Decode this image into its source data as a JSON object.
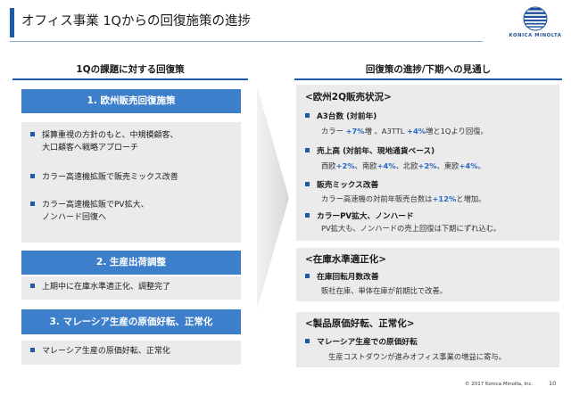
{
  "header": {
    "title": "オフィス事業 1Qからの回復施策の進捗"
  },
  "logo": {
    "text": "KONICA MINOLTA"
  },
  "left": {
    "heading": "1Qの課題に対する回復策",
    "sections": [
      {
        "title": "1. 欧州販売回復施策",
        "items": [
          [
            "採算重視の方針のもと、中規模顧客、",
            "大口顧客へ戦略アプローチ"
          ],
          [
            "カラー高速機拡販で販売ミックス改善"
          ],
          [
            "カラー高速機拡販でPV拡大、",
            "ノンハード回復へ"
          ]
        ]
      },
      {
        "title": "2. 生産出荷調整",
        "items": [
          [
            "上期中に在庫水準適正化、調整完了"
          ]
        ]
      },
      {
        "title": "3. マレーシア生産の原価好転、正常化",
        "items": [
          [
            "マレーシア生産の原価好転、正常化"
          ]
        ]
      }
    ]
  },
  "right": {
    "heading": "回復策の進捗/下期への見通し",
    "panel1": {
      "title": "<欧州2Q販売状況>",
      "a3": {
        "label": "A3台数 (対前年)",
        "p1": "カラー ",
        "v1": "+7%",
        "p2": "増 、A3TTL ",
        "v2": "+4%",
        "p3": "増と1Qより回復。"
      },
      "sales": {
        "label": "売上高 (対前年、現地通貨ベース)",
        "p1": "西欧",
        "v1": "+2%",
        "p2": "、南欧",
        "v2": "+4%",
        "p3": "、北欧",
        "v3": "+2%",
        "p4": "、東欧",
        "v4": "+4%",
        "p5": "。"
      },
      "mix": {
        "label": "販売ミックス改善",
        "p1": "カラー高速機の対前年販売台数は",
        "v1": "+12%",
        "p2": "と増加。"
      },
      "pv": {
        "label": "カラーPV拡大、ノンハード",
        "detail": "PV拡大も、ノンハードの売上回復は下期にずれ込む。"
      }
    },
    "panel2": {
      "title": "<在庫水準適正化>",
      "sub": "在庫回転月数改善",
      "detail": "販社在庫、単体在庫が前期比で改善。"
    },
    "panel3": {
      "title": "<製品原価好転、正常化>",
      "sub": "マレーシア生産での原価好転",
      "detail": "生産コストダウンが進みオフィス事業の増益に寄与。"
    }
  },
  "footer": {
    "copyright": "© 2017 Konica Minolta, Inc.",
    "page": "10"
  }
}
